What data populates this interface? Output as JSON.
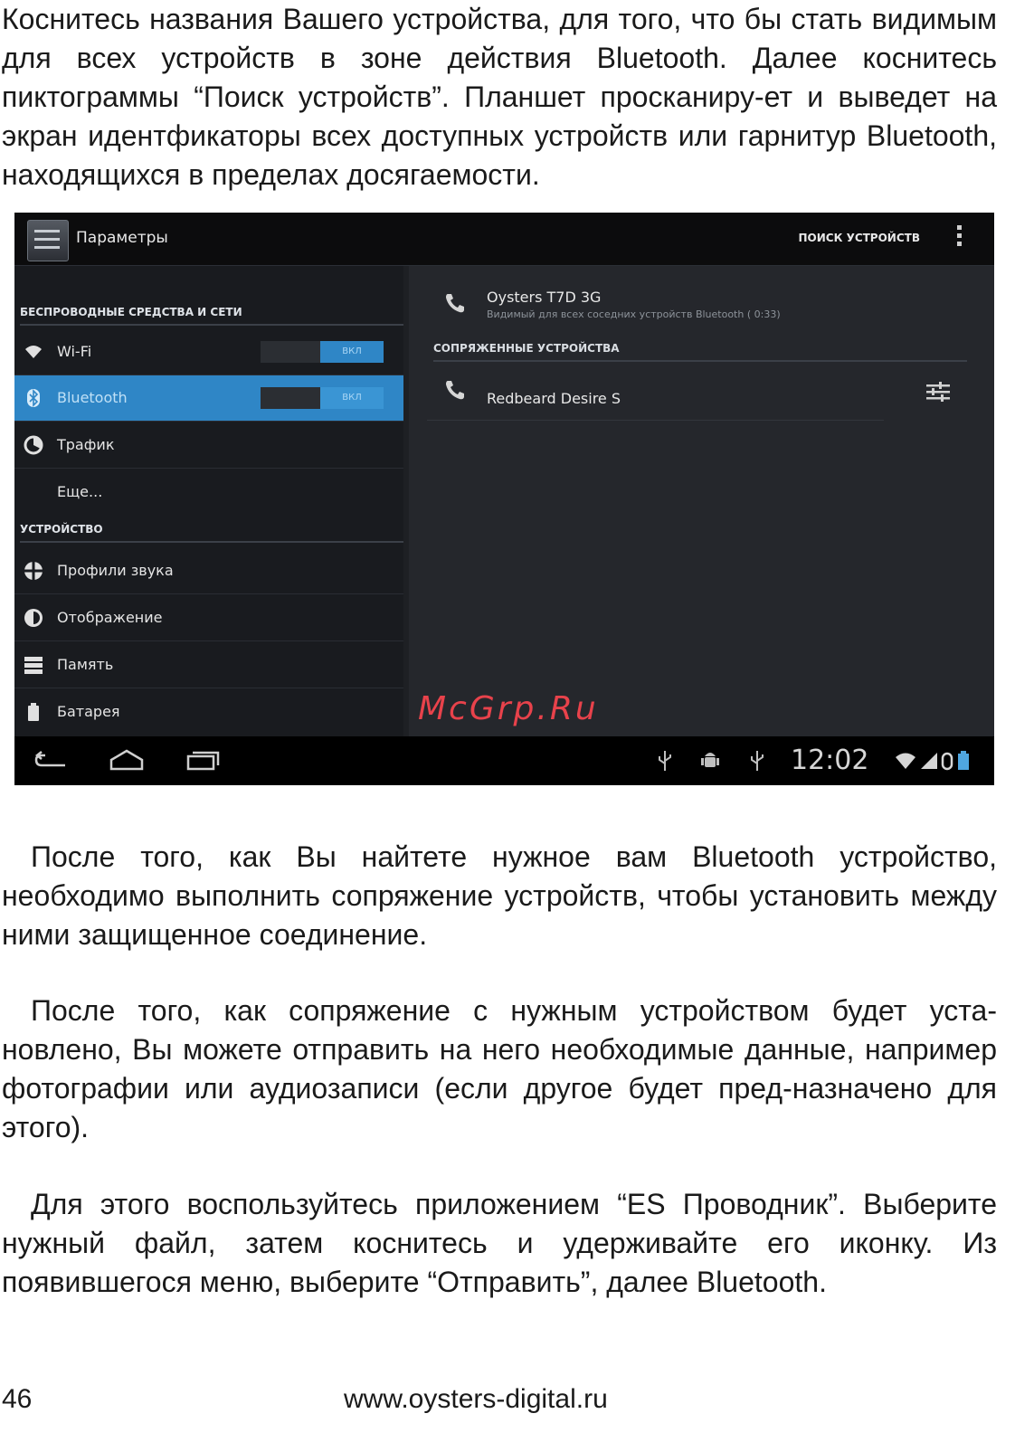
{
  "text": {
    "p1": "Коснитесь названия Вашего устройства, для того, что бы стать видимым для всех устройств в зоне действия Bluetooth. Далее коснитесь пиктограммы “Поиск устройств”. Планшет просканиру-ет и выведет на экран идентфикаторы всех доступных устройств или гарнитур Bluetooth, находящихся в пределах досягаемости.",
    "p2": "После того, как Вы найтете нужное вам Bluetooth устройство, необходимо выполнить сопряжение устройств, чтобы установить между ними защищенное соединение.",
    "p3": "После того, как сопряжение с нужным устройством будет уста-новлено, Вы можете отправить на него необходимые данные, например фотографии или аудиозаписи (если другое будет пред-назначено для этого).",
    "p4": "Для этого воспользуйтесь приложением “ES Проводник”. Выберите нужный файл, затем коснитесь и удерживайте его иконку. Из появившегося меню, выберите “Отправить”, далее Bluetooth."
  },
  "screenshot": {
    "action_bar": {
      "title": "Параметры",
      "search_label": "ПОИСК УСТРОЙСТВ",
      "menu_icon": "overflow-menu-icon"
    },
    "left_panel": {
      "section_wireless": "БЕСПРОВОДНЫЕ СРЕДСТВА И СЕТИ",
      "section_device": "УСТРОЙСТВО",
      "items": [
        {
          "label": "Wi-Fi",
          "icon": "wifi-icon",
          "toggle": "ВКЛ"
        },
        {
          "label": "Bluetooth",
          "icon": "bluetooth-icon",
          "toggle": "ВКЛ"
        },
        {
          "label": "Трафик",
          "icon": "data-usage-icon"
        },
        {
          "label": "Еще..."
        },
        {
          "label": "Профили звука",
          "icon": "sound-icon"
        },
        {
          "label": "Отображение",
          "icon": "display-icon"
        },
        {
          "label": "Память",
          "icon": "storage-icon"
        },
        {
          "label": "Батарея",
          "icon": "battery-icon"
        }
      ]
    },
    "right_panel": {
      "this_device": {
        "name": "Oysters T7D 3G",
        "status": "Видимый для всех соседних устройств Bluetooth ( 0:33)"
      },
      "paired_header": "СОПРЯЖЕННЫЕ УСТРОЙСТВА",
      "paired_devices": [
        {
          "name": "Redbeard Desire S"
        }
      ]
    },
    "status_bar": {
      "time": "12:02"
    },
    "watermark": "McGrp.Ru"
  },
  "footer": {
    "page_number": "46",
    "website": "www.oysters-digital.ru"
  }
}
